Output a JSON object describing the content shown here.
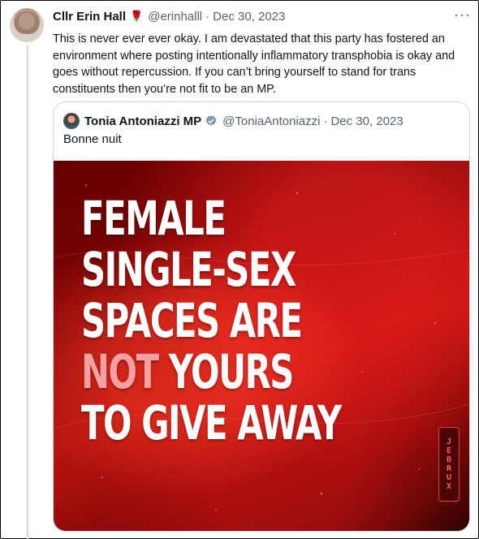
{
  "tweet": {
    "author_name": "Cllr Erin Hall",
    "author_emoji": "🌹",
    "handle": "@erinhalll",
    "separator": "·",
    "date": "Dec 30, 2023",
    "more_label": "···",
    "text": "This is never ever ever okay. I am devastated that this party has fostered an environment where posting intentionally inflammatory transphobia is okay and goes without repercussion. If you can’t bring yourself to stand for trans constituents then you’re not fit to be an MP."
  },
  "quote": {
    "author_name": "Tonia Antoniazzi MP",
    "handle": "@ToniaAntoniazzi",
    "separator": "·",
    "date": "Dec 30, 2023",
    "text": "Bonne nuit",
    "image": {
      "lines": [
        "FEMALE",
        "SINGLE-SEX",
        "SPACES ARE"
      ],
      "highlight": "NOT",
      "line4_rest": " YOURS",
      "line5": "TO GIVE AWAY",
      "badge_letters": [
        "J",
        "E",
        "B",
        "R",
        "U",
        "X"
      ]
    }
  },
  "colors": {
    "muted": "#536471",
    "border": "#cfd9de",
    "verified": "#829aab",
    "highlight": "#f2a0a0",
    "poster_red": "#c0150f"
  },
  "icons": {
    "verified": "verified-badge-icon",
    "more": "more-options-icon"
  }
}
